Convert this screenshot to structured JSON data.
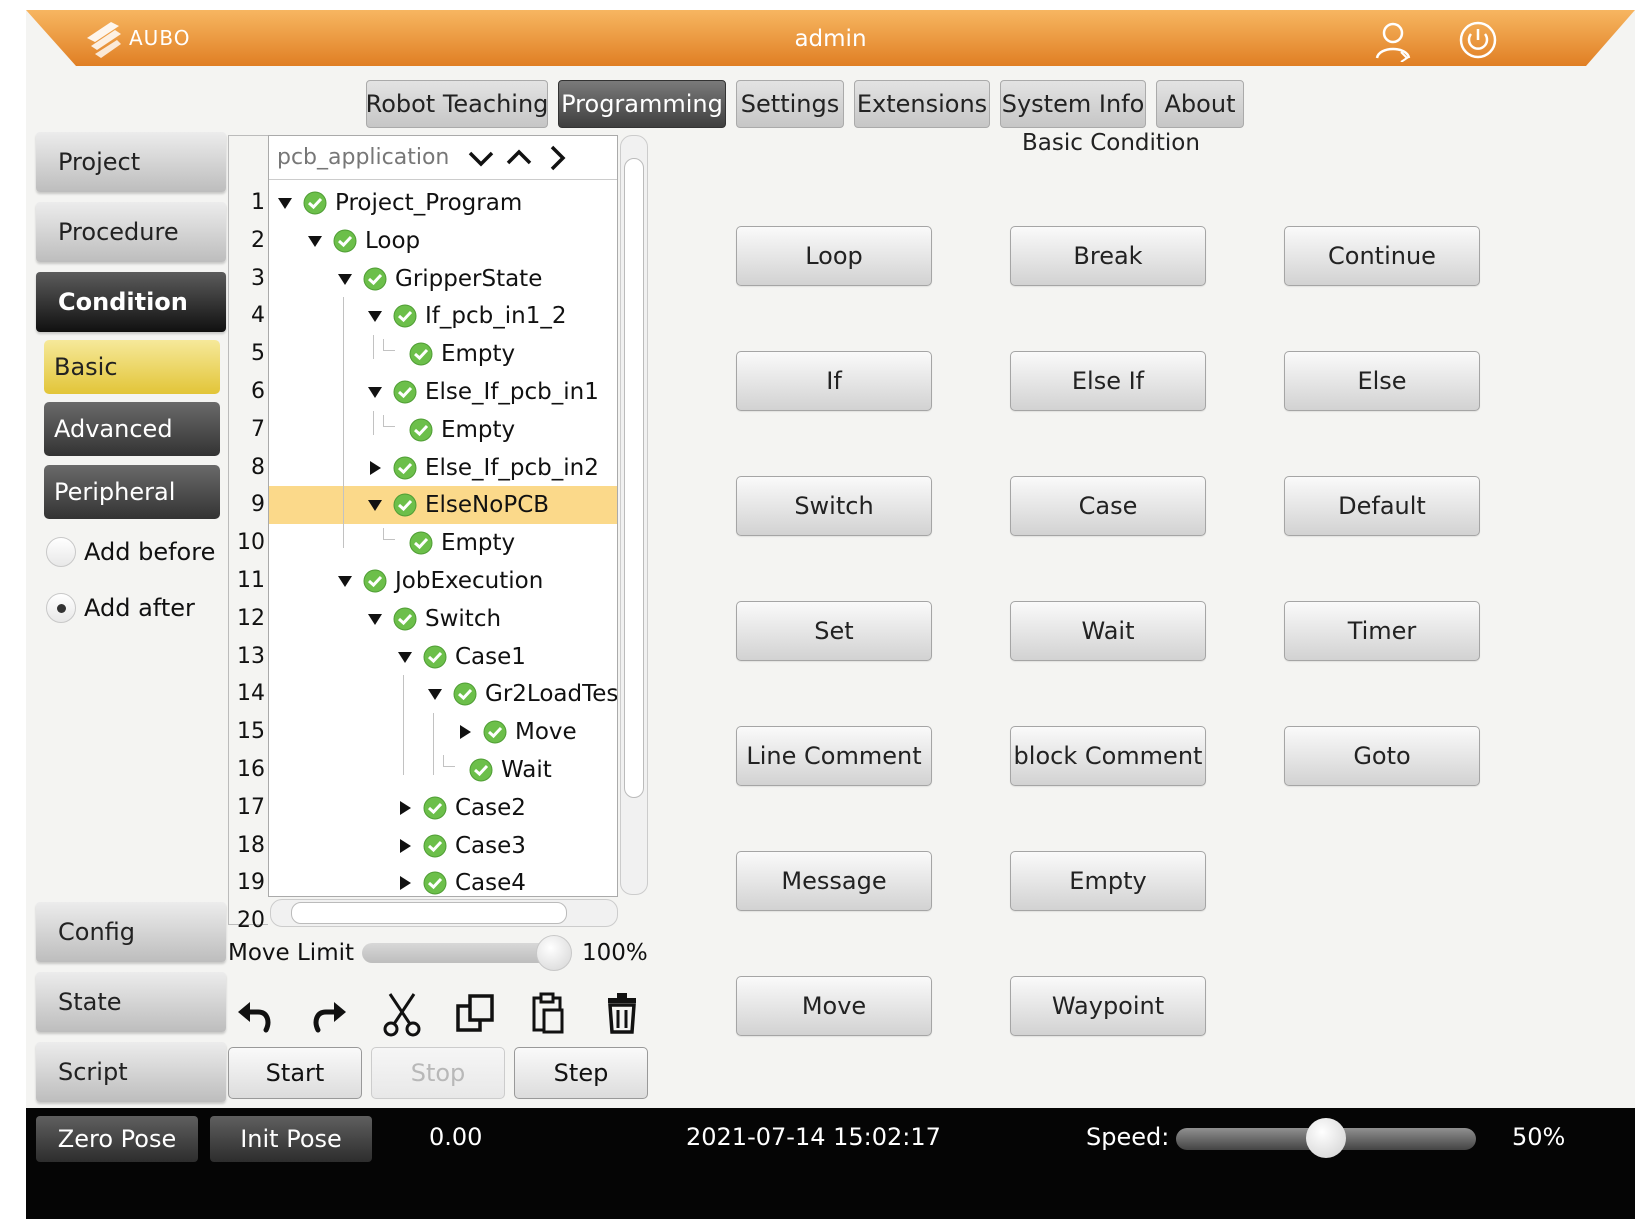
{
  "header": {
    "logo_text": "AUBO",
    "user": "admin",
    "icons": [
      "user-icon",
      "power-icon"
    ],
    "accent_color": "#f09a3e"
  },
  "tabs": [
    {
      "label": "Robot Teaching",
      "active": false
    },
    {
      "label": "Programming",
      "active": true
    },
    {
      "label": "Settings",
      "active": false
    },
    {
      "label": "Extensions",
      "active": false
    },
    {
      "label": "System Info",
      "active": false
    },
    {
      "label": "About",
      "active": false
    }
  ],
  "sidebar": {
    "project": "Project",
    "procedure": "Procedure",
    "condition": "Condition",
    "basic": "Basic",
    "advanced": "Advanced",
    "peripheral": "Peripheral",
    "add_before": "Add before",
    "add_after": "Add after",
    "add_mode": "after",
    "config": "Config",
    "state": "State",
    "script": "Script"
  },
  "tree": {
    "program_name": "pcb_application",
    "line_numbers": [
      "1",
      "2",
      "3",
      "4",
      "5",
      "6",
      "7",
      "8",
      "9",
      "10",
      "11",
      "12",
      "13",
      "14",
      "15",
      "16",
      "17",
      "18",
      "19",
      "20"
    ],
    "nodes": [
      {
        "label": "Project_Program",
        "expanded": true
      },
      {
        "label": "Loop",
        "expanded": true
      },
      {
        "label": "GripperState",
        "expanded": true
      },
      {
        "label": "If_pcb_in1_2",
        "expanded": true
      },
      {
        "label": "Empty"
      },
      {
        "label": "Else_If_pcb_in1",
        "expanded": true
      },
      {
        "label": "Empty"
      },
      {
        "label": "Else_If_pcb_in2",
        "expanded": false
      },
      {
        "label": "ElseNoPCB",
        "expanded": true,
        "selected": true
      },
      {
        "label": "Empty"
      },
      {
        "label": "JobExecution",
        "expanded": true
      },
      {
        "label": "Switch",
        "expanded": true
      },
      {
        "label": "Case1",
        "expanded": true
      },
      {
        "label": "Gr2LoadTes",
        "expanded": true
      },
      {
        "label": "Move",
        "expanded": false
      },
      {
        "label": "Wait"
      },
      {
        "label": "Case2",
        "expanded": false
      },
      {
        "label": "Case3",
        "expanded": false
      },
      {
        "label": "Case4",
        "expanded": false
      }
    ]
  },
  "move_limit": {
    "label": "Move Limit",
    "value_text": "100%",
    "value": 1.0
  },
  "edit_tools": [
    "undo-icon",
    "redo-icon",
    "cut-icon",
    "copy-icon",
    "paste-icon",
    "delete-icon"
  ],
  "run": {
    "start": "Start",
    "stop": "Stop",
    "step": "Step",
    "stop_enabled": false
  },
  "main": {
    "section_title": "Basic Condition",
    "buttons": [
      [
        "Loop",
        "Break",
        "Continue"
      ],
      [
        "If",
        "Else If",
        "Else"
      ],
      [
        "Switch",
        "Case",
        "Default"
      ],
      [
        "Set",
        "Wait",
        "Timer"
      ],
      [
        "Line Comment",
        "block Comment",
        "Goto"
      ],
      [
        "Message",
        "Empty"
      ],
      [
        "Move",
        "Waypoint"
      ]
    ]
  },
  "footer": {
    "zero_pose": "Zero Pose",
    "init_pose": "Init Pose",
    "value": "0.00",
    "datetime": "2021-07-14 15:02:17",
    "speed_label": "Speed:",
    "speed_text": "50%",
    "speed": 0.5
  }
}
